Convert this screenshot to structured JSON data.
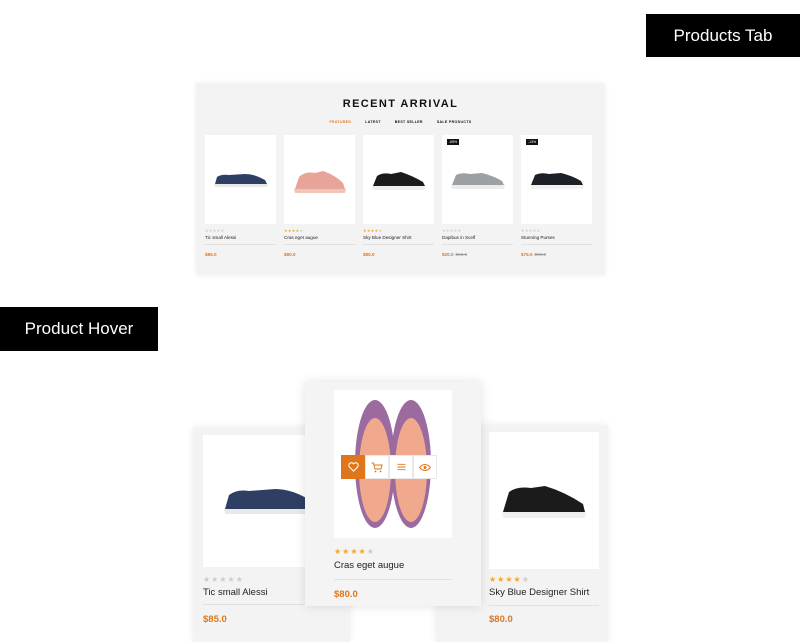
{
  "labels": {
    "products_tab": "Products Tab",
    "product_hover": "Product Hover"
  },
  "section": {
    "title": "RECENT ARRIVAL",
    "tabs": [
      "FEATURED",
      "LATEST",
      "BEST SELLER",
      "SALE PRODUCTS"
    ],
    "active_tab": "FEATURED",
    "products": [
      {
        "name": "Tic small Alessi",
        "price": "$85.0",
        "old_price": "",
        "badge": "",
        "rating": 0,
        "shoe": "navy-slipon"
      },
      {
        "name": "Cras eget augue",
        "price": "$80.0",
        "old_price": "",
        "badge": "",
        "rating": 4,
        "shoe": "pink-runner"
      },
      {
        "name": "Sky Blue Designer Shirt",
        "price": "$80.0",
        "old_price": "",
        "badge": "",
        "rating": 4,
        "shoe": "black-sneaker"
      },
      {
        "name": "Dapibus in Scelf",
        "price": "$20.0",
        "old_price": "$65.0",
        "badge": "-65%",
        "rating": 0,
        "shoe": "grey-lowtop"
      },
      {
        "name": "Stunning Purses",
        "price": "$75.0",
        "old_price": "$98.0",
        "badge": "-13%",
        "rating": 0,
        "shoe": "black-lowtop"
      }
    ]
  },
  "hover": {
    "left": {
      "name": "Tic small Alessi",
      "price": "$85.0",
      "rating": 0
    },
    "center": {
      "name": "Cras eget augue",
      "price": "$80.0",
      "rating": 4
    },
    "right": {
      "name": "Sky Blue Designer Shirt",
      "price": "$80.0",
      "rating": 4
    },
    "actions": [
      "wishlist-icon",
      "cart-icon",
      "compare-icon",
      "quickview-icon"
    ]
  },
  "colors": {
    "accent": "#e0761c",
    "star": "#f5a623",
    "panel_bg": "#f3f3f3",
    "label_bg": "#000000"
  }
}
